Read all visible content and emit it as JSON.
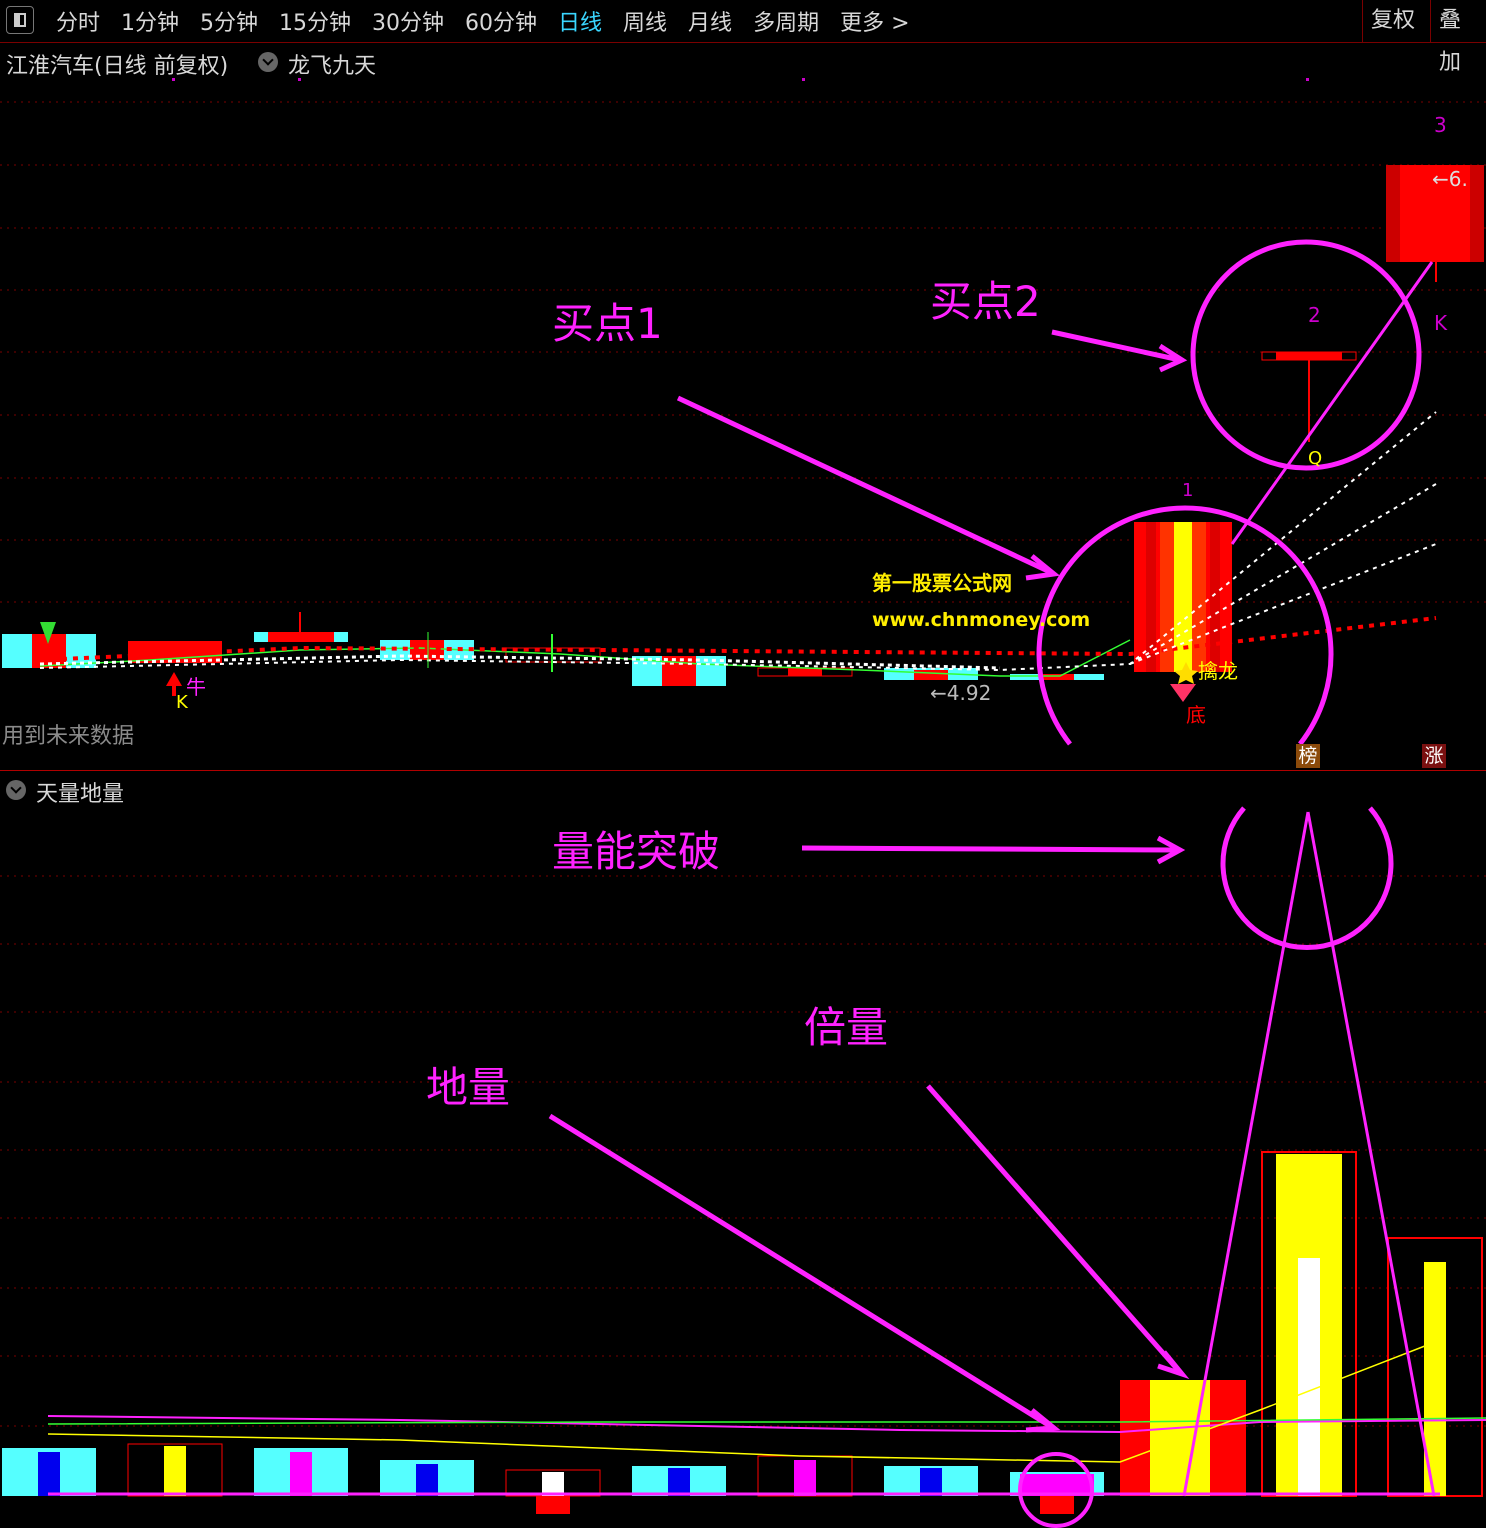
{
  "toolbar": {
    "tabs": [
      "分时",
      "1分钟",
      "5分钟",
      "15分钟",
      "30分钟",
      "60分钟",
      "日线",
      "周线",
      "月线",
      "多周期",
      "更多 >"
    ],
    "active_tab": "日线",
    "restore_right": "复权",
    "overlay": "叠加"
  },
  "main_panel": {
    "title": "江淮汽车(日线 前复权)",
    "indicator": "龙飞九天",
    "future_data_note": "用到未来数据",
    "labels": {
      "buy_point_1": "买点1",
      "buy_point_2": "买点2",
      "marker_1": "1",
      "marker_2": "2",
      "marker_3": "3",
      "marker_k": "K",
      "marker_k2": "K",
      "marker_q": "Q",
      "price_low": "←4.92",
      "price_high": "←6.",
      "cow": "牛",
      "dragon": "擒龙",
      "bottom": "底",
      "watermark_cn": "第一股票公式网",
      "watermark_url": "www.chnmoney.com"
    },
    "badges": [
      "榜",
      "涨"
    ]
  },
  "volume_panel": {
    "title": "天量地量",
    "labels": {
      "breakthrough": "量能突破",
      "double_volume": "倍量",
      "ground_volume": "地量"
    }
  },
  "colors": {
    "annotation": "#ff22ff",
    "up": "#ff0000",
    "down": "#55ffff",
    "accent_yellow": "#ffff00",
    "active_tab": "#3ad6ff"
  }
}
